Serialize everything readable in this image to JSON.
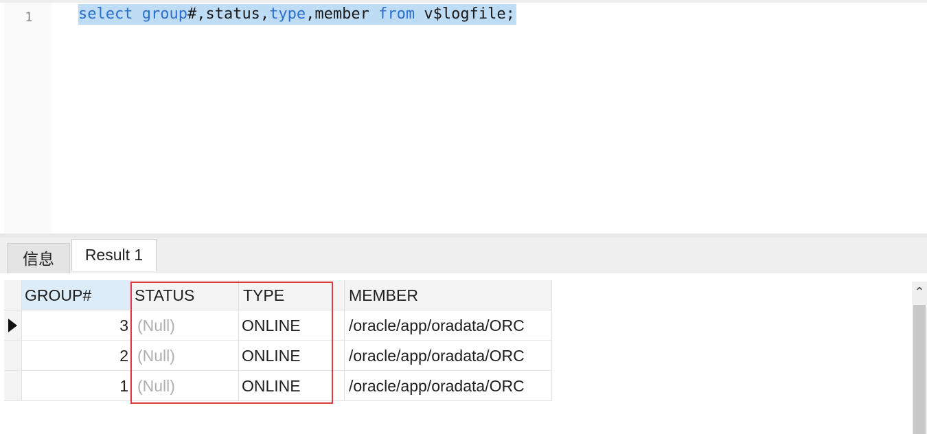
{
  "editor": {
    "line_number": "1",
    "tokens": {
      "select": "select",
      "sp1": " ",
      "group": "group",
      "mid1": "#,status,",
      "type": "type",
      "mid2": ",member ",
      "from": "from",
      "rest": " v$logfile;"
    }
  },
  "tabs": {
    "info_label": "信息",
    "result_label": "Result 1"
  },
  "grid": {
    "columns": [
      "GROUP#",
      "STATUS",
      "TYPE",
      "MEMBER"
    ],
    "rows": [
      {
        "group": "3",
        "status": "(Null)",
        "type": "ONLINE",
        "member": "/oracle/app/oradata/ORC"
      },
      {
        "group": "2",
        "status": "(Null)",
        "type": "ONLINE",
        "member": "/oracle/app/oradata/ORC"
      },
      {
        "group": "1",
        "status": "(Null)",
        "type": "ONLINE",
        "member": "/oracle/app/oradata/ORC"
      }
    ]
  },
  "colors": {
    "selection": "#bfdcf5",
    "keyword": "#2a6fc9",
    "highlight_box": "#e03c3c",
    "null_text": "#b0b0b0"
  },
  "icons": {
    "row_indicator": "current-row-arrow-icon",
    "scroll_up": "chevron-up-icon"
  }
}
